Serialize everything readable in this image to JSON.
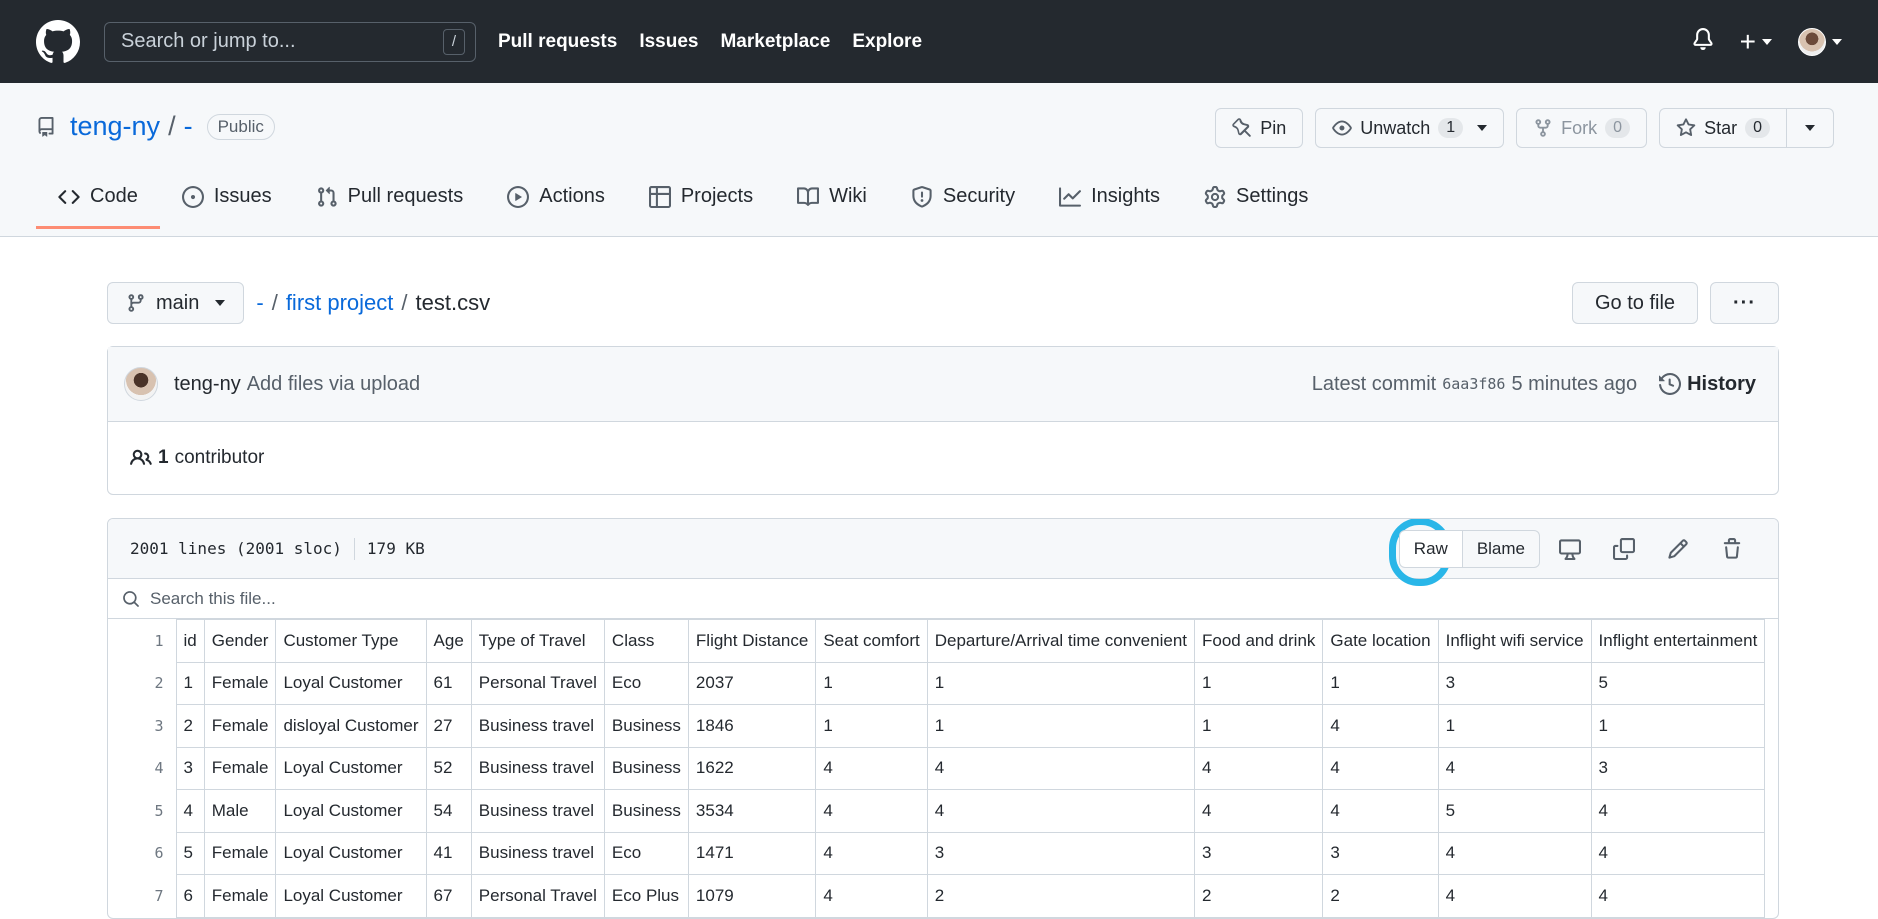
{
  "header": {
    "search_placeholder": "Search or jump to...",
    "search_shortcut": "/",
    "nav": [
      "Pull requests",
      "Issues",
      "Marketplace",
      "Explore"
    ]
  },
  "repo": {
    "owner": "teng-ny",
    "separator": "/",
    "name": "-",
    "visibility": "Public",
    "actions": {
      "pin": "Pin",
      "unwatch": "Unwatch",
      "watch_count": "1",
      "fork": "Fork",
      "fork_count": "0",
      "star": "Star",
      "star_count": "0"
    },
    "tabs": [
      "Code",
      "Issues",
      "Pull requests",
      "Actions",
      "Projects",
      "Wiki",
      "Security",
      "Insights",
      "Settings"
    ]
  },
  "path": {
    "branch": "main",
    "crumbs": [
      "-",
      "first project"
    ],
    "file": "test.csv",
    "go_to_file": "Go to file",
    "more": "···"
  },
  "commit": {
    "author": "teng-ny",
    "message": "Add files via upload",
    "latest_label": "Latest commit",
    "sha": "6aa3f86",
    "time": "5 minutes ago",
    "history": "History",
    "contributors_count": "1",
    "contributors_label": "contributor"
  },
  "file": {
    "lines": "2001 lines (2001 sloc)",
    "size": "179 KB",
    "raw": "Raw",
    "blame": "Blame",
    "search_placeholder": "Search this file...",
    "columns": [
      "id",
      "Gender",
      "Customer Type",
      "Age",
      "Type of Travel",
      "Class",
      "Flight Distance",
      "Seat comfort",
      "Departure/Arrival time convenient",
      "Food and drink",
      "Gate location",
      "Inflight wifi service",
      "Inflight entertainment"
    ],
    "rows": [
      [
        "1",
        "Female",
        "Loyal Customer",
        "61",
        "Personal Travel",
        "Eco",
        "2037",
        "1",
        "1",
        "1",
        "1",
        "3",
        "5"
      ],
      [
        "2",
        "Female",
        "disloyal Customer",
        "27",
        "Business travel",
        "Business",
        "1846",
        "1",
        "1",
        "1",
        "4",
        "1",
        "1"
      ],
      [
        "3",
        "Female",
        "Loyal Customer",
        "52",
        "Business travel",
        "Business",
        "1622",
        "4",
        "4",
        "4",
        "4",
        "4",
        "3"
      ],
      [
        "4",
        "Male",
        "Loyal Customer",
        "54",
        "Business travel",
        "Business",
        "3534",
        "4",
        "4",
        "4",
        "4",
        "5",
        "4"
      ],
      [
        "5",
        "Female",
        "Loyal Customer",
        "41",
        "Business travel",
        "Eco",
        "1471",
        "4",
        "3",
        "3",
        "3",
        "4",
        "4"
      ],
      [
        "6",
        "Female",
        "Loyal Customer",
        "67",
        "Personal Travel",
        "Eco Plus",
        "1079",
        "4",
        "2",
        "2",
        "2",
        "4",
        "4"
      ]
    ],
    "line_numbers": [
      "1",
      "2",
      "3",
      "4",
      "5",
      "6",
      "7"
    ]
  }
}
